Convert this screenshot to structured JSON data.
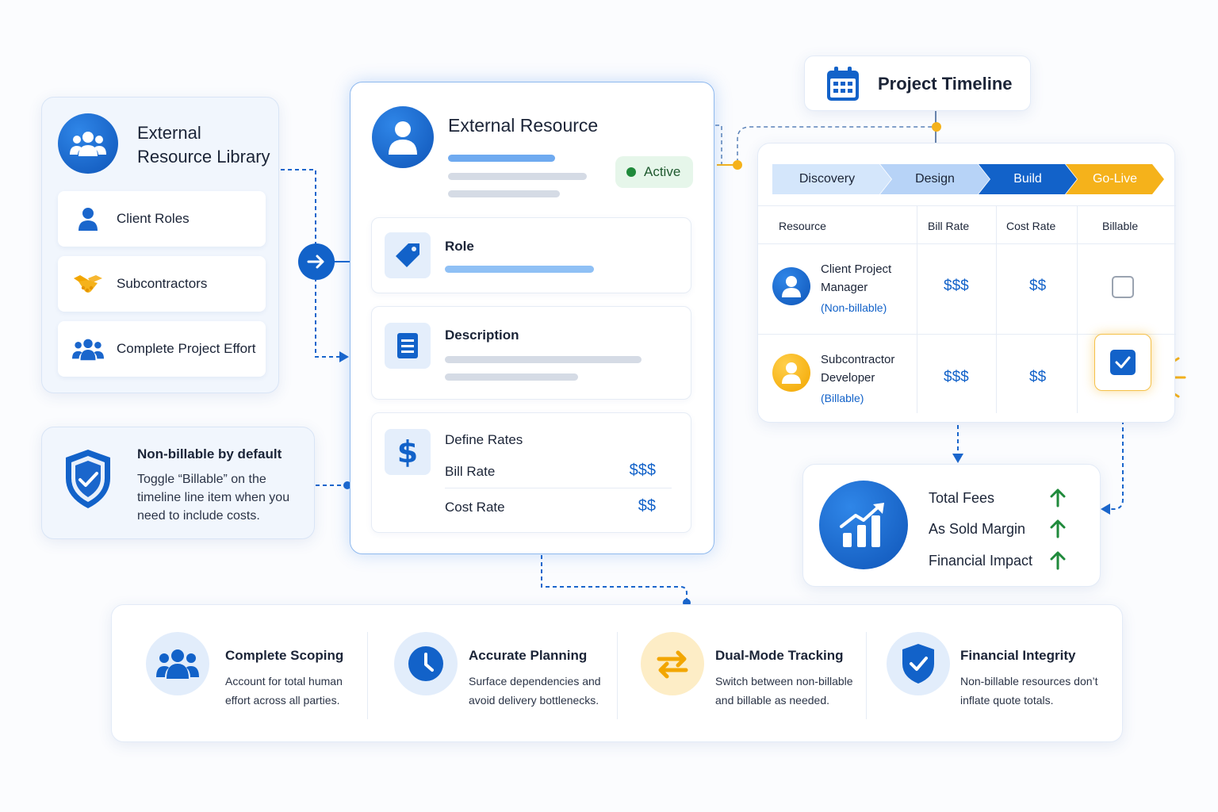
{
  "library": {
    "title_line1": "External",
    "title_line2": "Resource Library",
    "items": [
      {
        "label": "Client Roles",
        "icon": "person-icon"
      },
      {
        "label": "Subcontractors",
        "icon": "handshake-icon"
      },
      {
        "label": "Complete Project Effort",
        "icon": "group-icon"
      }
    ]
  },
  "note": {
    "title": "Non-billable by default",
    "body": "Toggle “Billable” on the timeline line item when you need to include costs."
  },
  "resource": {
    "title": "External Resource",
    "status": "Active",
    "role_label": "Role",
    "description_label": "Description",
    "rates_label": "Define Rates",
    "bill_rate_label": "Bill Rate",
    "bill_rate_value": "$$$",
    "cost_rate_label": "Cost Rate",
    "cost_rate_value": "$$"
  },
  "timeline": {
    "title": "Project Timeline",
    "phases": [
      "Discovery",
      "Design",
      "Build",
      "Go-Live"
    ],
    "columns": [
      "Resource",
      "Bill Rate",
      "Cost Rate",
      "Billable"
    ],
    "rows": [
      {
        "name_line1": "Client Project",
        "name_line2": "Manager",
        "tag": "(Non-billable)",
        "bill": "$$$",
        "cost": "$$",
        "billable": false
      },
      {
        "name_line1": "Subcontractor",
        "name_line2": "Developer",
        "tag": "(Billable)",
        "bill": "$$$",
        "cost": "$$",
        "billable": true
      }
    ]
  },
  "impact": {
    "items": [
      "Total Fees",
      "As Sold Margin",
      "Financial Impact"
    ]
  },
  "features": [
    {
      "title": "Complete Scoping",
      "line1": "Account for total human",
      "line2": "effort across all parties."
    },
    {
      "title": "Accurate Planning",
      "line1": "Surface dependencies and",
      "line2": "avoid delivery bottlenecks."
    },
    {
      "title": "Dual-Mode Tracking",
      "line1": "Switch between non-billable",
      "line2": "and billable as needed."
    },
    {
      "title": "Financial Integrity",
      "line1": "Non-billable resources don’t",
      "line2": "inflate quote totals."
    }
  ],
  "colors": {
    "primary": "#1262c9",
    "accent_yellow": "#f5b21b",
    "status_green": "#1f8a3b",
    "status_bg": "#e6f6ea"
  }
}
